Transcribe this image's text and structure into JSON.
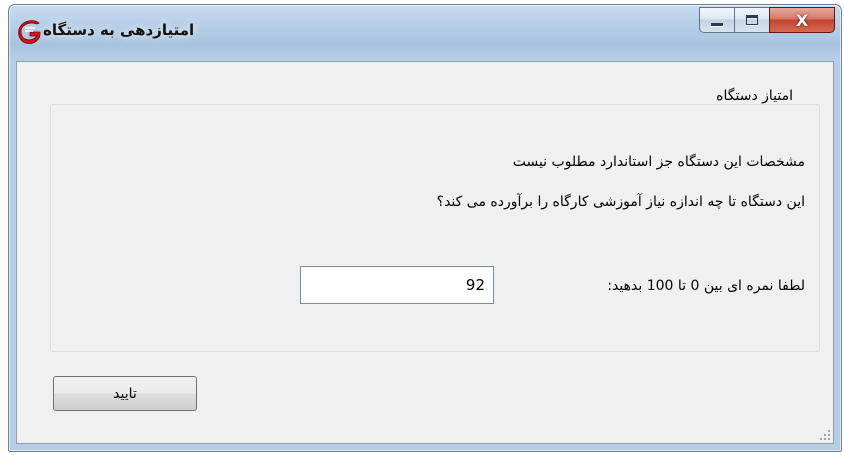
{
  "window": {
    "title": "امتیازدهی به دستگاه",
    "controls": [
      "minimize",
      "maximize",
      "close"
    ],
    "close_glyph": "X"
  },
  "group": {
    "legend": "امتیاز دستگاه",
    "spec_text": "مشخصات این دستگاه جز استاندارد مطلوب نیست",
    "question_text": "این دستگاه تا چه اندازه نیاز آموزشی کارگاه را برآورده می کند؟",
    "score_label": "لطفا نمره ای بین 0 تا 100 بدهید:",
    "score_value": "92"
  },
  "buttons": {
    "ok_label": "تایید"
  },
  "icons": {
    "app": "app-logo-icon",
    "minimize": "minimize-icon",
    "maximize": "maximize-icon",
    "close": "close-icon",
    "grip": "resize-grip-icon"
  },
  "colors": {
    "titlebar": "#b8d0e8",
    "client": "#f0f0f0",
    "close_button": "#c24530"
  }
}
